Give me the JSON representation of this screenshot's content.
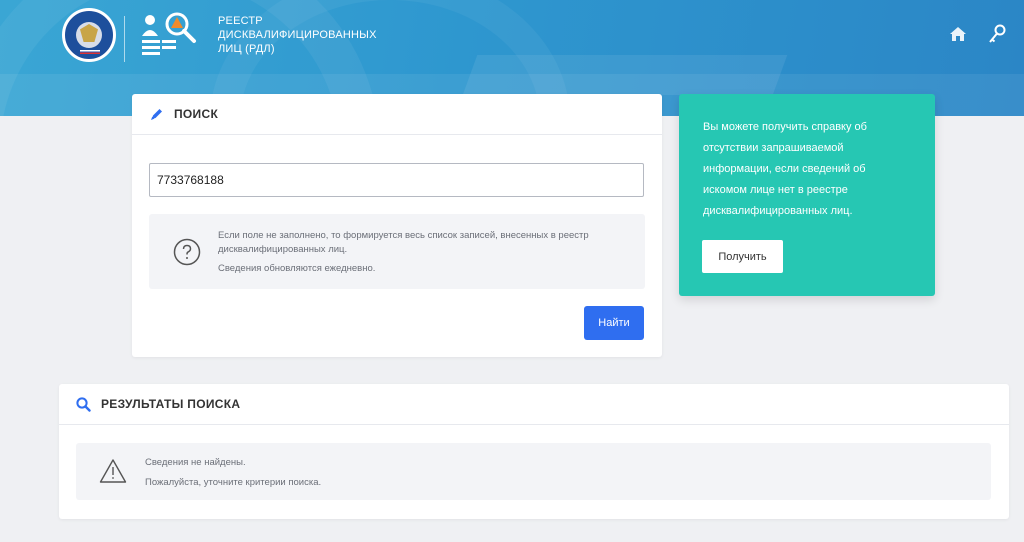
{
  "header": {
    "title_lines": [
      "РЕЕСТР",
      "ДИСКВАЛИФИЦИРОВАННЫХ",
      "ЛИЦ (РДЛ)"
    ],
    "icons": [
      "fns-emblem-logo",
      "registry-icon",
      "home-icon",
      "key-icon"
    ]
  },
  "search": {
    "heading": "ПОИСК",
    "input_value": "7733768188",
    "help_line1": "Если поле не заполнено, то формируется весь список записей, внесенных в реестр дисквалифицированных лиц.",
    "help_line2": "Сведения обновляются ежедневно.",
    "submit_label": "Найти"
  },
  "promo": {
    "text": "Вы можете получить справку об отсутствии запрашиваемой информации, если сведений об искомом лице нет в реестре дисквалифицированных лиц.",
    "button_label": "Получить"
  },
  "results": {
    "heading": "РЕЗУЛЬТАТЫ ПОИСКА",
    "line1": "Сведения не найдены.",
    "line2": "Пожалуйста, уточните критерии поиска."
  },
  "colors": {
    "header": "#2e97cf",
    "primary_button": "#2f6ef0",
    "promo": "#26c7b3",
    "page_bg": "#eff0f3"
  }
}
